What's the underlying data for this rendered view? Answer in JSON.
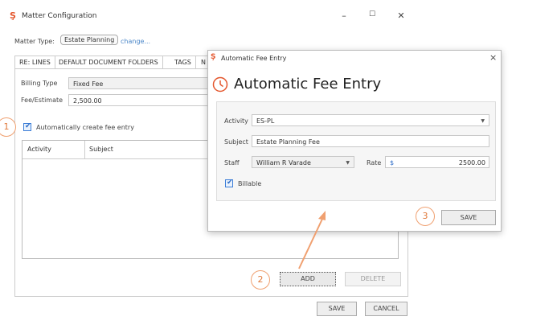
{
  "main_window": {
    "title": "Matter Configuration",
    "controls": [
      "–",
      "☐",
      "✕"
    ],
    "matter_type_label": "Matter Type:",
    "matter_type_value": "Estate Planning",
    "change_link": "change...",
    "tabs": [
      "RE: LINES",
      "DEFAULT DOCUMENT FOLDERS",
      "TAGS",
      "N"
    ],
    "billing_type_label": "Billing Type",
    "billing_type_value": "Fixed Fee",
    "fee_estimate_label": "Fee/Estimate",
    "fee_estimate_value": "2,500.00",
    "auto_create_label": "Automatically create fee entry",
    "grid_headers": [
      "Activity",
      "Subject"
    ],
    "add_label": "ADD",
    "delete_label": "DELETE",
    "save_label": "SAVE",
    "cancel_label": "CANCEL"
  },
  "dialog": {
    "titlebar": "Automatic Fee Entry",
    "close": "×",
    "heading": "Automatic Fee Entry",
    "activity_label": "Activity",
    "activity_value": "ES-PL",
    "subject_label": "Subject",
    "subject_value": "Estate Planning Fee",
    "staff_label": "Staff",
    "staff_value": "William R Varade",
    "rate_label": "Rate",
    "currency": "$",
    "rate_value": "2500.00",
    "billable_label": "Billable",
    "save_label": "SAVE"
  },
  "callouts": [
    "1",
    "2",
    "3"
  ],
  "colors": {
    "accent": "#e4572e",
    "arrow": "#f0a070",
    "check_blue": "#2d6cc7"
  }
}
